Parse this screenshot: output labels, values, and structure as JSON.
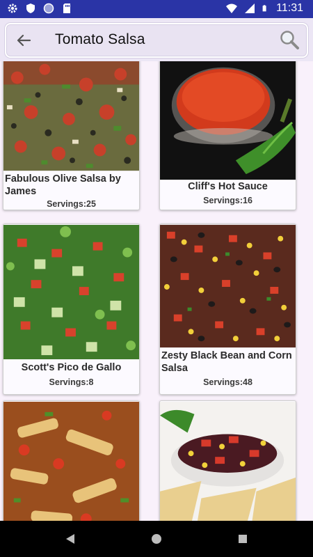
{
  "status_bar": {
    "time": "11:31",
    "icons_left": [
      "gear-icon",
      "shield-icon",
      "circle-icon",
      "sd-card-icon"
    ],
    "icons_right": [
      "wifi-icon",
      "signal-icon",
      "battery-icon"
    ]
  },
  "search": {
    "query": "Tomato Salsa",
    "back_icon": "arrow-left-icon",
    "search_icon": "magnifier-icon"
  },
  "recipes": [
    {
      "title": "Fabulous Olive Salsa by James",
      "servings": "Servings:25",
      "image": "olive-salsa-photo"
    },
    {
      "title": "Cliff's Hot Sauce",
      "servings": "Servings:16",
      "image": "hot-sauce-photo"
    },
    {
      "title": "Scott's Pico de Gallo",
      "servings": "Servings:8",
      "image": "pico-de-gallo-photo"
    },
    {
      "title": "Zesty Black Bean and Corn Salsa",
      "servings": "Servings:48",
      "image": "black-bean-corn-salsa-photo"
    },
    {
      "title": "",
      "servings": "",
      "image": "chicken-stir-fry-photo"
    },
    {
      "title": "",
      "servings": "",
      "image": "bean-salsa-chips-photo"
    }
  ],
  "nav": {
    "back_icon": "triangle-back-icon",
    "home_icon": "circle-home-icon",
    "recent_icon": "square-recents-icon"
  },
  "colors": {
    "status_bar": "#2a34a6",
    "app_bar": "#ece6f5",
    "page_background": "#f9f1fb",
    "card_background": "#fcfaff"
  }
}
